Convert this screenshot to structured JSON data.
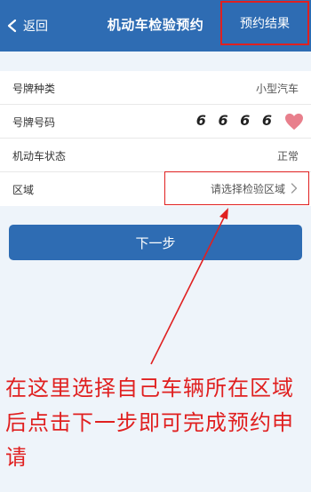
{
  "navbar": {
    "back_label": "返回",
    "title": "机动车检验预约",
    "result_label": "预约结果"
  },
  "form": {
    "rows": [
      {
        "label": "号牌种类",
        "value": "小型汽车"
      },
      {
        "label": "号牌号码",
        "value": "6 6 6 6"
      },
      {
        "label": "机动车状态",
        "value": "正常"
      },
      {
        "label": "区域",
        "value": "请选择检验区域"
      }
    ]
  },
  "next_button": {
    "label": "下一步"
  },
  "annotation": {
    "text": "在这里选择自己车辆所在区域后点击下一步即可完成预约申请"
  },
  "colors": {
    "brand": "#2e6cb3",
    "highlight_red": "#e02020",
    "heart": "#e87f8c"
  },
  "icons": [
    "chevron-left-icon",
    "heart-icon",
    "chevron-right-icon",
    "arrow-icon"
  ]
}
